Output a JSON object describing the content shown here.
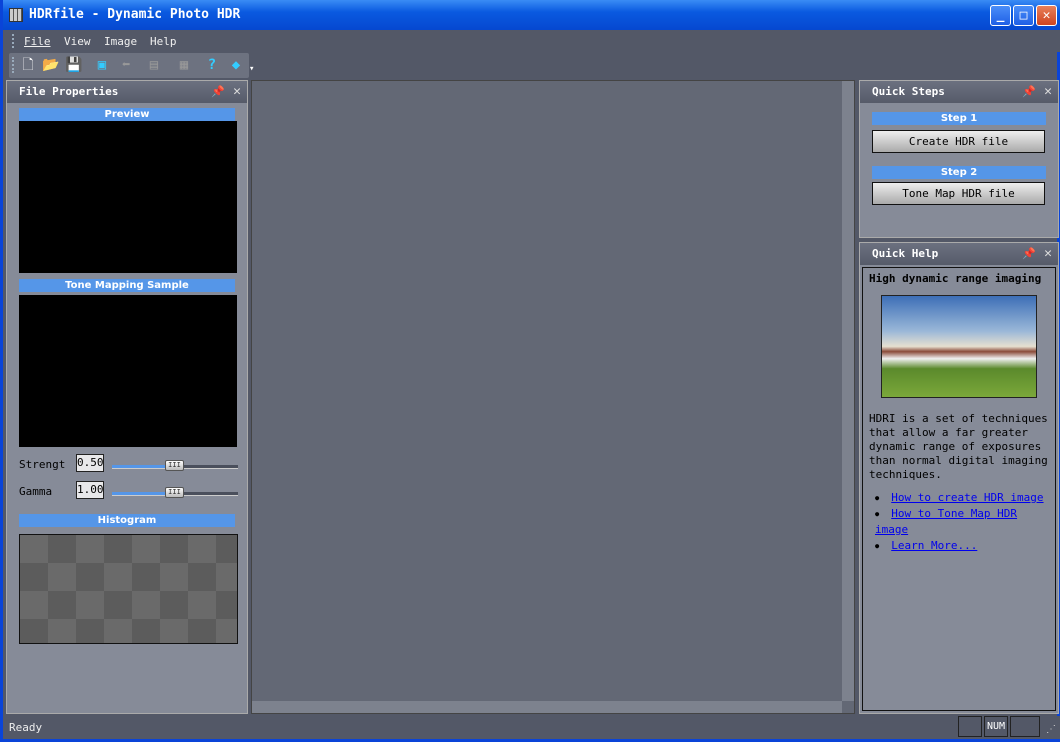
{
  "window": {
    "title": "HDRfile - Dynamic Photo HDR",
    "minimize": "_",
    "maximize": "□",
    "close": "✕"
  },
  "menu": [
    "File",
    "View",
    "Image",
    "Help"
  ],
  "toolbar": [
    "new-icon",
    "open-icon",
    "save-icon",
    "save-as-icon",
    "back-icon",
    "stack-icon",
    "clipboard-icon",
    "help-icon",
    "book-icon"
  ],
  "left_panel": {
    "title": "File Properties",
    "preview": "Preview",
    "tone_sample": "Tone Mapping Sample",
    "strength_label": "Strengt",
    "strength_value": "0.50",
    "strength_pct": 50,
    "gamma_label": "Gamma",
    "gamma_value": "1.00",
    "gamma_pct": 50,
    "histogram": "Histogram"
  },
  "quick_steps": {
    "title": "Quick Steps",
    "step1": "Step 1",
    "step1_button": "Create HDR file",
    "step2": "Step 2",
    "step2_button": "Tone Map HDR file"
  },
  "quick_help": {
    "title": "Quick Help",
    "heading": "High dynamic range imaging",
    "body": "HDRI is a set of techniques that allow a far greater dynamic range of exposures than normal digital imaging techniques.",
    "links": [
      "How to create HDR image",
      "How to Tone Map HDR image",
      "Learn More..."
    ]
  },
  "status": {
    "text": "Ready",
    "num": "NUM"
  }
}
